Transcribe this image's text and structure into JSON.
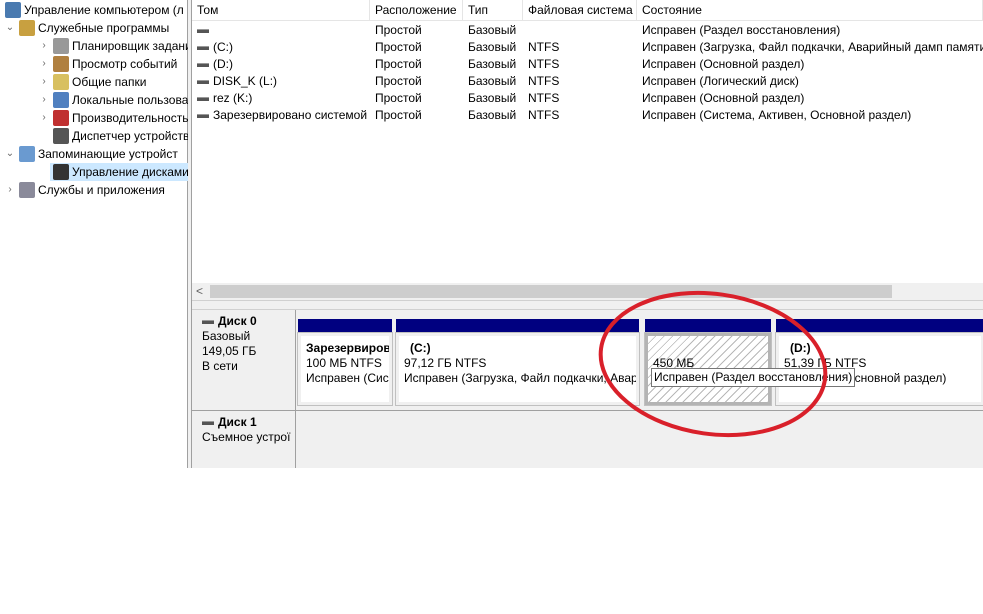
{
  "tree": [
    {
      "label": "Управление компьютером (л",
      "level": 0,
      "chev": ""
    },
    {
      "label": "Служебные программы",
      "level": 0,
      "chev": "v"
    },
    {
      "label": "Планировщик заданий",
      "level": 1,
      "chev": ">"
    },
    {
      "label": "Просмотр событий",
      "level": 1,
      "chev": ">"
    },
    {
      "label": "Общие папки",
      "level": 1,
      "chev": ">"
    },
    {
      "label": "Локальные пользовате",
      "level": 1,
      "chev": ">"
    },
    {
      "label": "Производительность",
      "level": 1,
      "chev": ">"
    },
    {
      "label": "Диспетчер устройств",
      "level": 1,
      "chev": ""
    },
    {
      "label": "Запоминающие устройст",
      "level": 0,
      "chev": "v"
    },
    {
      "label": "Управление дисками",
      "level": 1,
      "chev": "",
      "selected": true
    },
    {
      "label": "Службы и приложения",
      "level": 0,
      "chev": ">"
    }
  ],
  "columns": [
    "Том",
    "Расположение",
    "Тип",
    "Файловая система",
    "Состояние"
  ],
  "volumes": [
    [
      "",
      "Простой",
      "Базовый",
      "",
      "Исправен (Раздел восстановления)"
    ],
    [
      "(C:)",
      "Простой",
      "Базовый",
      "NTFS",
      "Исправен (Загрузка, Файл подкачки, Аварийный дамп памяти"
    ],
    [
      "(D:)",
      "Простой",
      "Базовый",
      "NTFS",
      "Исправен (Основной раздел)"
    ],
    [
      "DISK_K (L:)",
      "Простой",
      "Базовый",
      "NTFS",
      "Исправен (Логический диск)"
    ],
    [
      "rez (K:)",
      "Простой",
      "Базовый",
      "NTFS",
      "Исправен (Основной раздел)"
    ],
    [
      "Зарезервировано системой",
      "Простой",
      "Базовый",
      "NTFS",
      "Исправен (Система, Активен, Основной раздел)"
    ]
  ],
  "scroll_left": "<",
  "disk0": {
    "name": "Диск 0",
    "type": "Базовый",
    "size": "149,05 ГБ",
    "status": "В сети",
    "partitions": [
      {
        "name": "Зарезервиров",
        "size": "100 МБ NTFS",
        "status": "Исправен (Сис"
      },
      {
        "name": "(C:)",
        "size": "97,12 ГБ NTFS",
        "status": "Исправен (Загрузка, Файл подкачки, Авар"
      },
      {
        "name": "",
        "size": "450 МБ",
        "status": ""
      },
      {
        "name": "(D:)",
        "size": "51,39 ГБ NTFS",
        "status": "Исправен (Основной раздел)"
      }
    ]
  },
  "disk1": {
    "name": "Диск 1",
    "type": "Съемное устрої"
  },
  "tooltip": "Исправен (Раздел восстановления)",
  "colors": {
    "partition_bar": "#000080",
    "annotation": "#d9202a",
    "selection": "#cce8ff"
  }
}
